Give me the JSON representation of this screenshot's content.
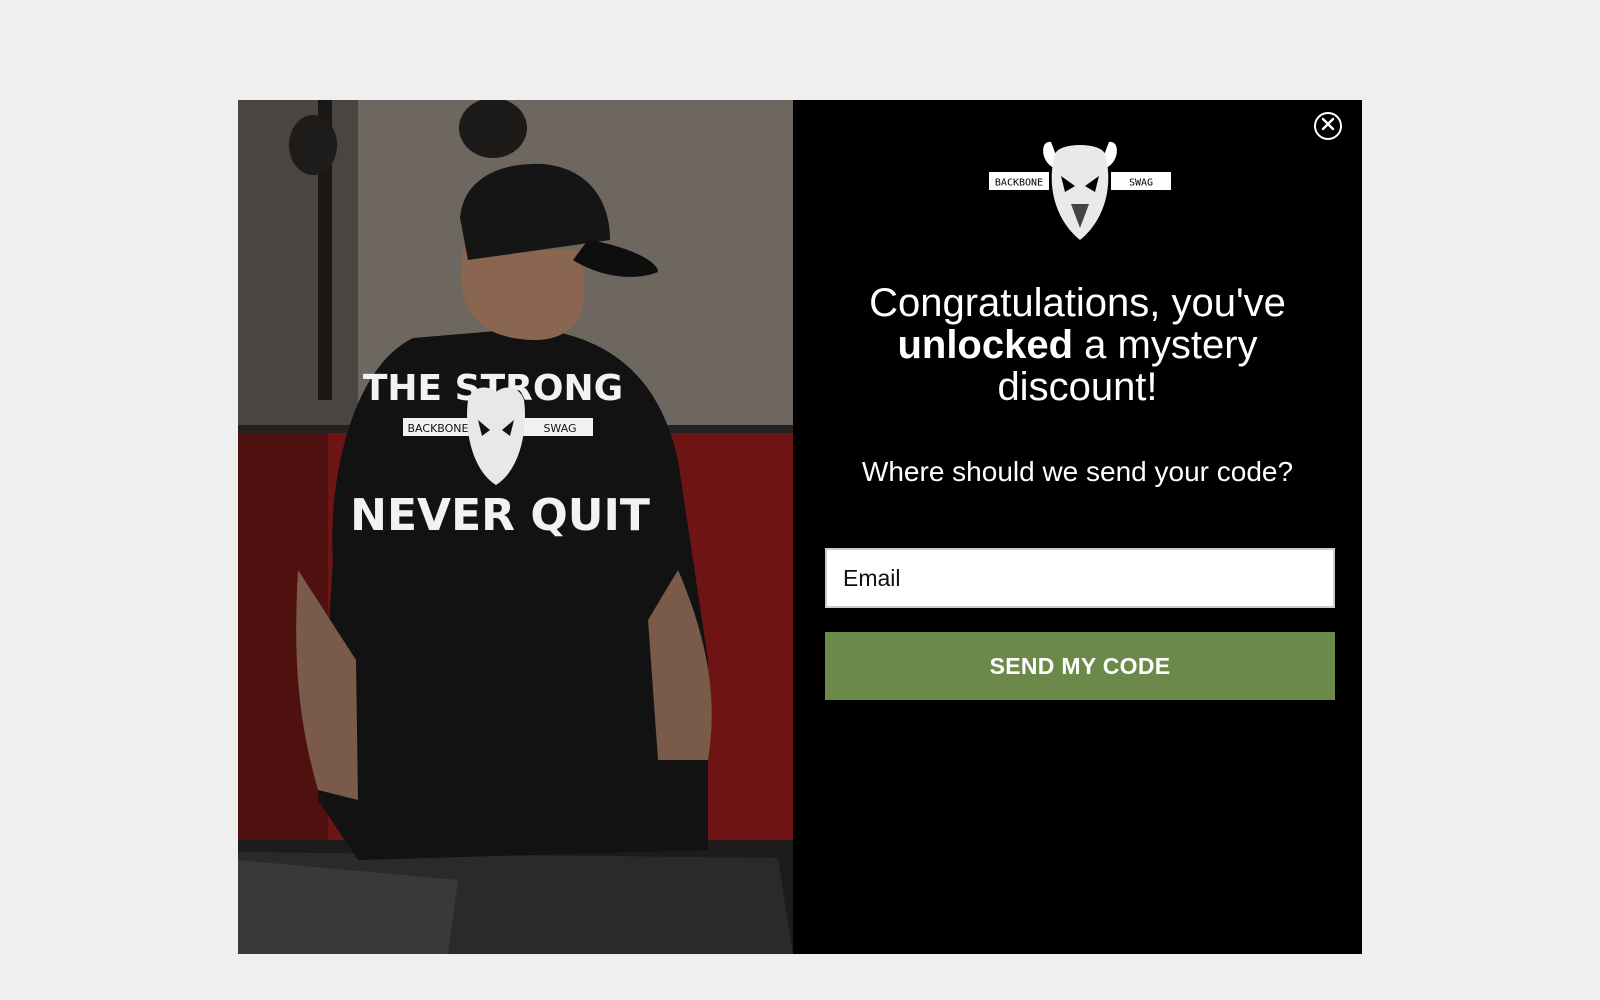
{
  "popup": {
    "headline_part1": "Congratulations, you've",
    "headline_bold": "unlocked",
    "headline_part2": "a mystery discount!",
    "subhead": "Where should we send your code?",
    "email_placeholder": "Email",
    "submit_label": "SEND MY CODE",
    "close_icon": "close-icon",
    "accent_color": "#6b8a4a"
  },
  "logo": {
    "left_text": "BACKBONE",
    "right_text": "SWAG"
  },
  "shirt": {
    "top_text": "THE STRONG",
    "bottom_text": "NEVER QUIT",
    "logo_left": "BACKBONE",
    "logo_right": "SWAG"
  }
}
